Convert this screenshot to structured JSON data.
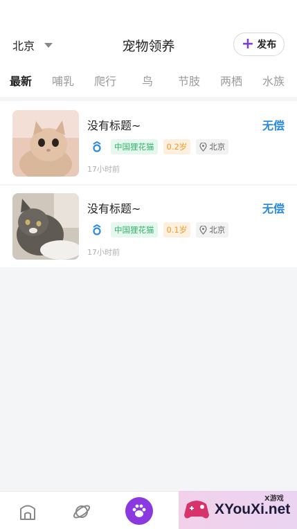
{
  "header": {
    "city": "北京",
    "title": "宠物领养",
    "publish_label": "发布"
  },
  "tabs": [
    {
      "label": "最新",
      "active": true
    },
    {
      "label": "哺乳",
      "active": false
    },
    {
      "label": "爬行",
      "active": false
    },
    {
      "label": "鸟",
      "active": false
    },
    {
      "label": "节肢",
      "active": false
    },
    {
      "label": "两栖",
      "active": false
    },
    {
      "label": "水族",
      "active": false
    }
  ],
  "listings": [
    {
      "title": "没有标题~",
      "price": "无偿",
      "breed": "中国狸花猫",
      "age": "0.2岁",
      "location": "北京",
      "time": "17小时前"
    },
    {
      "title": "没有标题~",
      "price": "无偿",
      "breed": "中国狸花猫",
      "age": "0.1岁",
      "location": "北京",
      "time": "17小时前"
    }
  ],
  "bottom_nav": {
    "items": [
      "home-icon",
      "planet-icon",
      "paw-icon"
    ]
  },
  "watermark": {
    "text": "XYouXi.net",
    "sub": "X游戏"
  },
  "colors": {
    "accent": "#8a39e0",
    "price": "#2c8ae0",
    "breed_tag": "#34b36a",
    "age_tag": "#ef9a2d"
  }
}
